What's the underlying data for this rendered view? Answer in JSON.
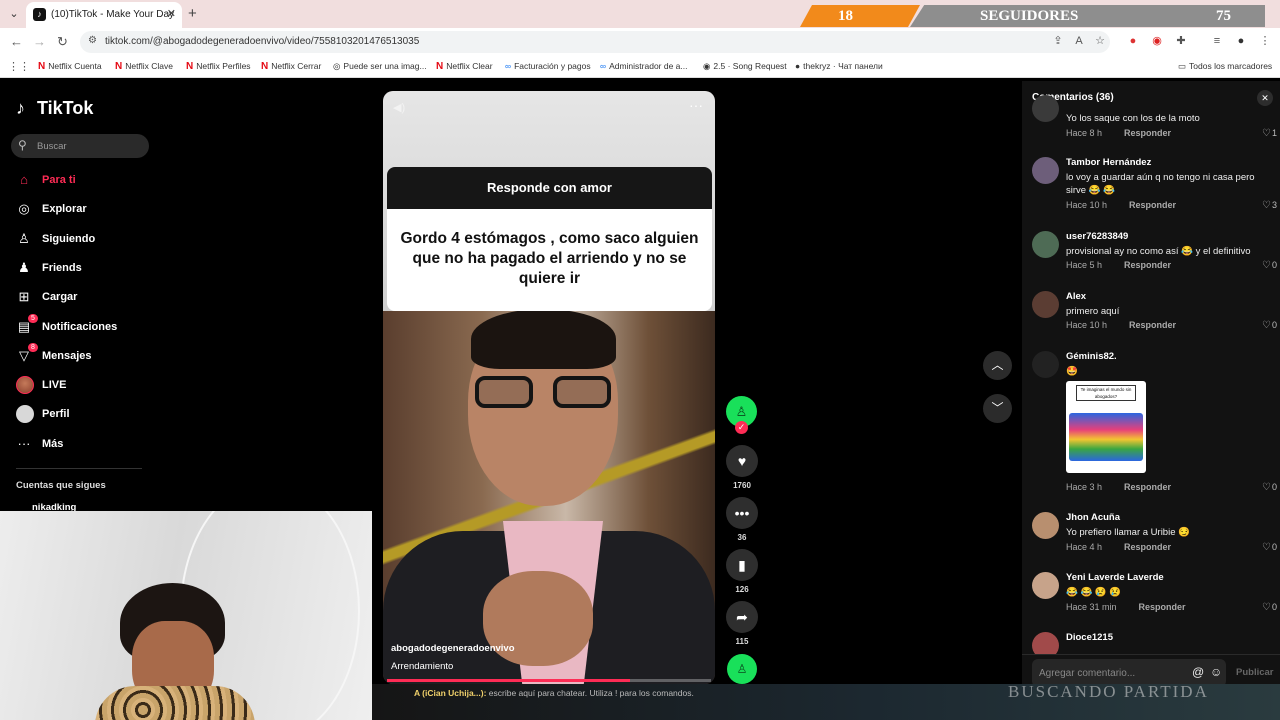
{
  "browser": {
    "tab_title": "(10)TikTok - Make Your Day",
    "tab_favicon": "tiktok-icon",
    "url": "tiktok.com/@abogadodegeneradoenvivo/video/7558103201476513035",
    "bookmarks": [
      {
        "label": "Netflix Cuenta",
        "icon": "netflix-icon"
      },
      {
        "label": "Netflix Clave",
        "icon": "netflix-icon"
      },
      {
        "label": "Netflix Perfiles",
        "icon": "netflix-icon"
      },
      {
        "label": "Netflix Cerrar",
        "icon": "netflix-icon"
      },
      {
        "label": "Puede ser una imag...",
        "icon": "globe-icon"
      },
      {
        "label": "Netflix Clear",
        "icon": "netflix-icon"
      },
      {
        "label": "Facturación y pagos",
        "icon": "meta-icon"
      },
      {
        "label": "Administrador de a...",
        "icon": "meta-icon"
      },
      {
        "label": "2.5 · Song Request",
        "icon": "song-icon"
      },
      {
        "label": "thekryz · Чат панели",
        "icon": "chat-icon"
      }
    ],
    "all_bookmarks": "Todos los marcadores"
  },
  "overlay": {
    "followers_count": "18",
    "followers_label": "SEGUIDORES",
    "followers_goal": "75"
  },
  "sidebar": {
    "logo": "TikTok",
    "search_placeholder": "Buscar",
    "items": [
      {
        "label": "Para ti",
        "icon": "home-icon",
        "active": true
      },
      {
        "label": "Explorar",
        "icon": "compass-icon"
      },
      {
        "label": "Siguiendo",
        "icon": "following-icon"
      },
      {
        "label": "Friends",
        "icon": "friends-icon"
      },
      {
        "label": "Cargar",
        "icon": "upload-icon"
      },
      {
        "label": "Notificaciones",
        "icon": "bell-icon",
        "badge": "5"
      },
      {
        "label": "Mensajes",
        "icon": "send-icon",
        "badge": "8"
      },
      {
        "label": "LIVE",
        "icon": "live-icon"
      },
      {
        "label": "Perfil",
        "icon": "profile-icon"
      },
      {
        "label": "Más",
        "icon": "more-icon"
      }
    ],
    "following_title": "Cuentas que sigues",
    "following_user": "nikadking"
  },
  "video": {
    "qa_header": "Responde con amor",
    "qa_question": "Gordo 4 estómagos , como saco alguien que no ha pagado el arriendo y no se quiere ir",
    "author": "abogadodegeneradoenvivo",
    "caption": "Arrendamiento",
    "progress": 0.75
  },
  "actions": {
    "likes": "1760",
    "comments": "36",
    "saves": "126",
    "shares": "115"
  },
  "comments": {
    "title": "Comentarios (36)",
    "reply_label": "Responder",
    "placeholder": "Agregar comentario...",
    "publish": "Publicar",
    "list": [
      {
        "user": "",
        "text": "Yo los saque con los de la moto",
        "time": "Hace 8 h",
        "likes": "1"
      },
      {
        "user": "Tambor Hernández",
        "text": "lo voy a guardar aún q no tengo ni casa pero sirve 😂 😂",
        "time": "Hace 10 h",
        "likes": "3"
      },
      {
        "user": "user76283849",
        "text": "provisional ay no como así 😂 y el definitivo",
        "time": "Hace 5 h",
        "likes": "0"
      },
      {
        "user": "Alex",
        "text": "primero aquí",
        "time": "Hace 10 h",
        "likes": "0"
      },
      {
        "user": "Géminis82.",
        "text": "🤩",
        "time": "Hace 3 h",
        "likes": "0",
        "sticker_caption": "Te imaginas el mundo sin abogados?"
      },
      {
        "user": "Jhon Acuña",
        "text": "Yo prefiero llamar a Uribie 😏",
        "time": "Hace 4 h",
        "likes": "0"
      },
      {
        "user": "Yeni Laverde Laverde",
        "text": "😂 😂 😢 😢",
        "time": "Hace 31 min",
        "likes": "0"
      },
      {
        "user": "Dioce1215",
        "text": "",
        "time": "",
        "likes": ""
      }
    ]
  },
  "stream": {
    "chat_user": "A (iCian Uchija...):",
    "chat_prompt": "escribe aquí para chatear. Utiliza ! para los comandos.",
    "title": "BUSCANDO PARTIDA"
  }
}
